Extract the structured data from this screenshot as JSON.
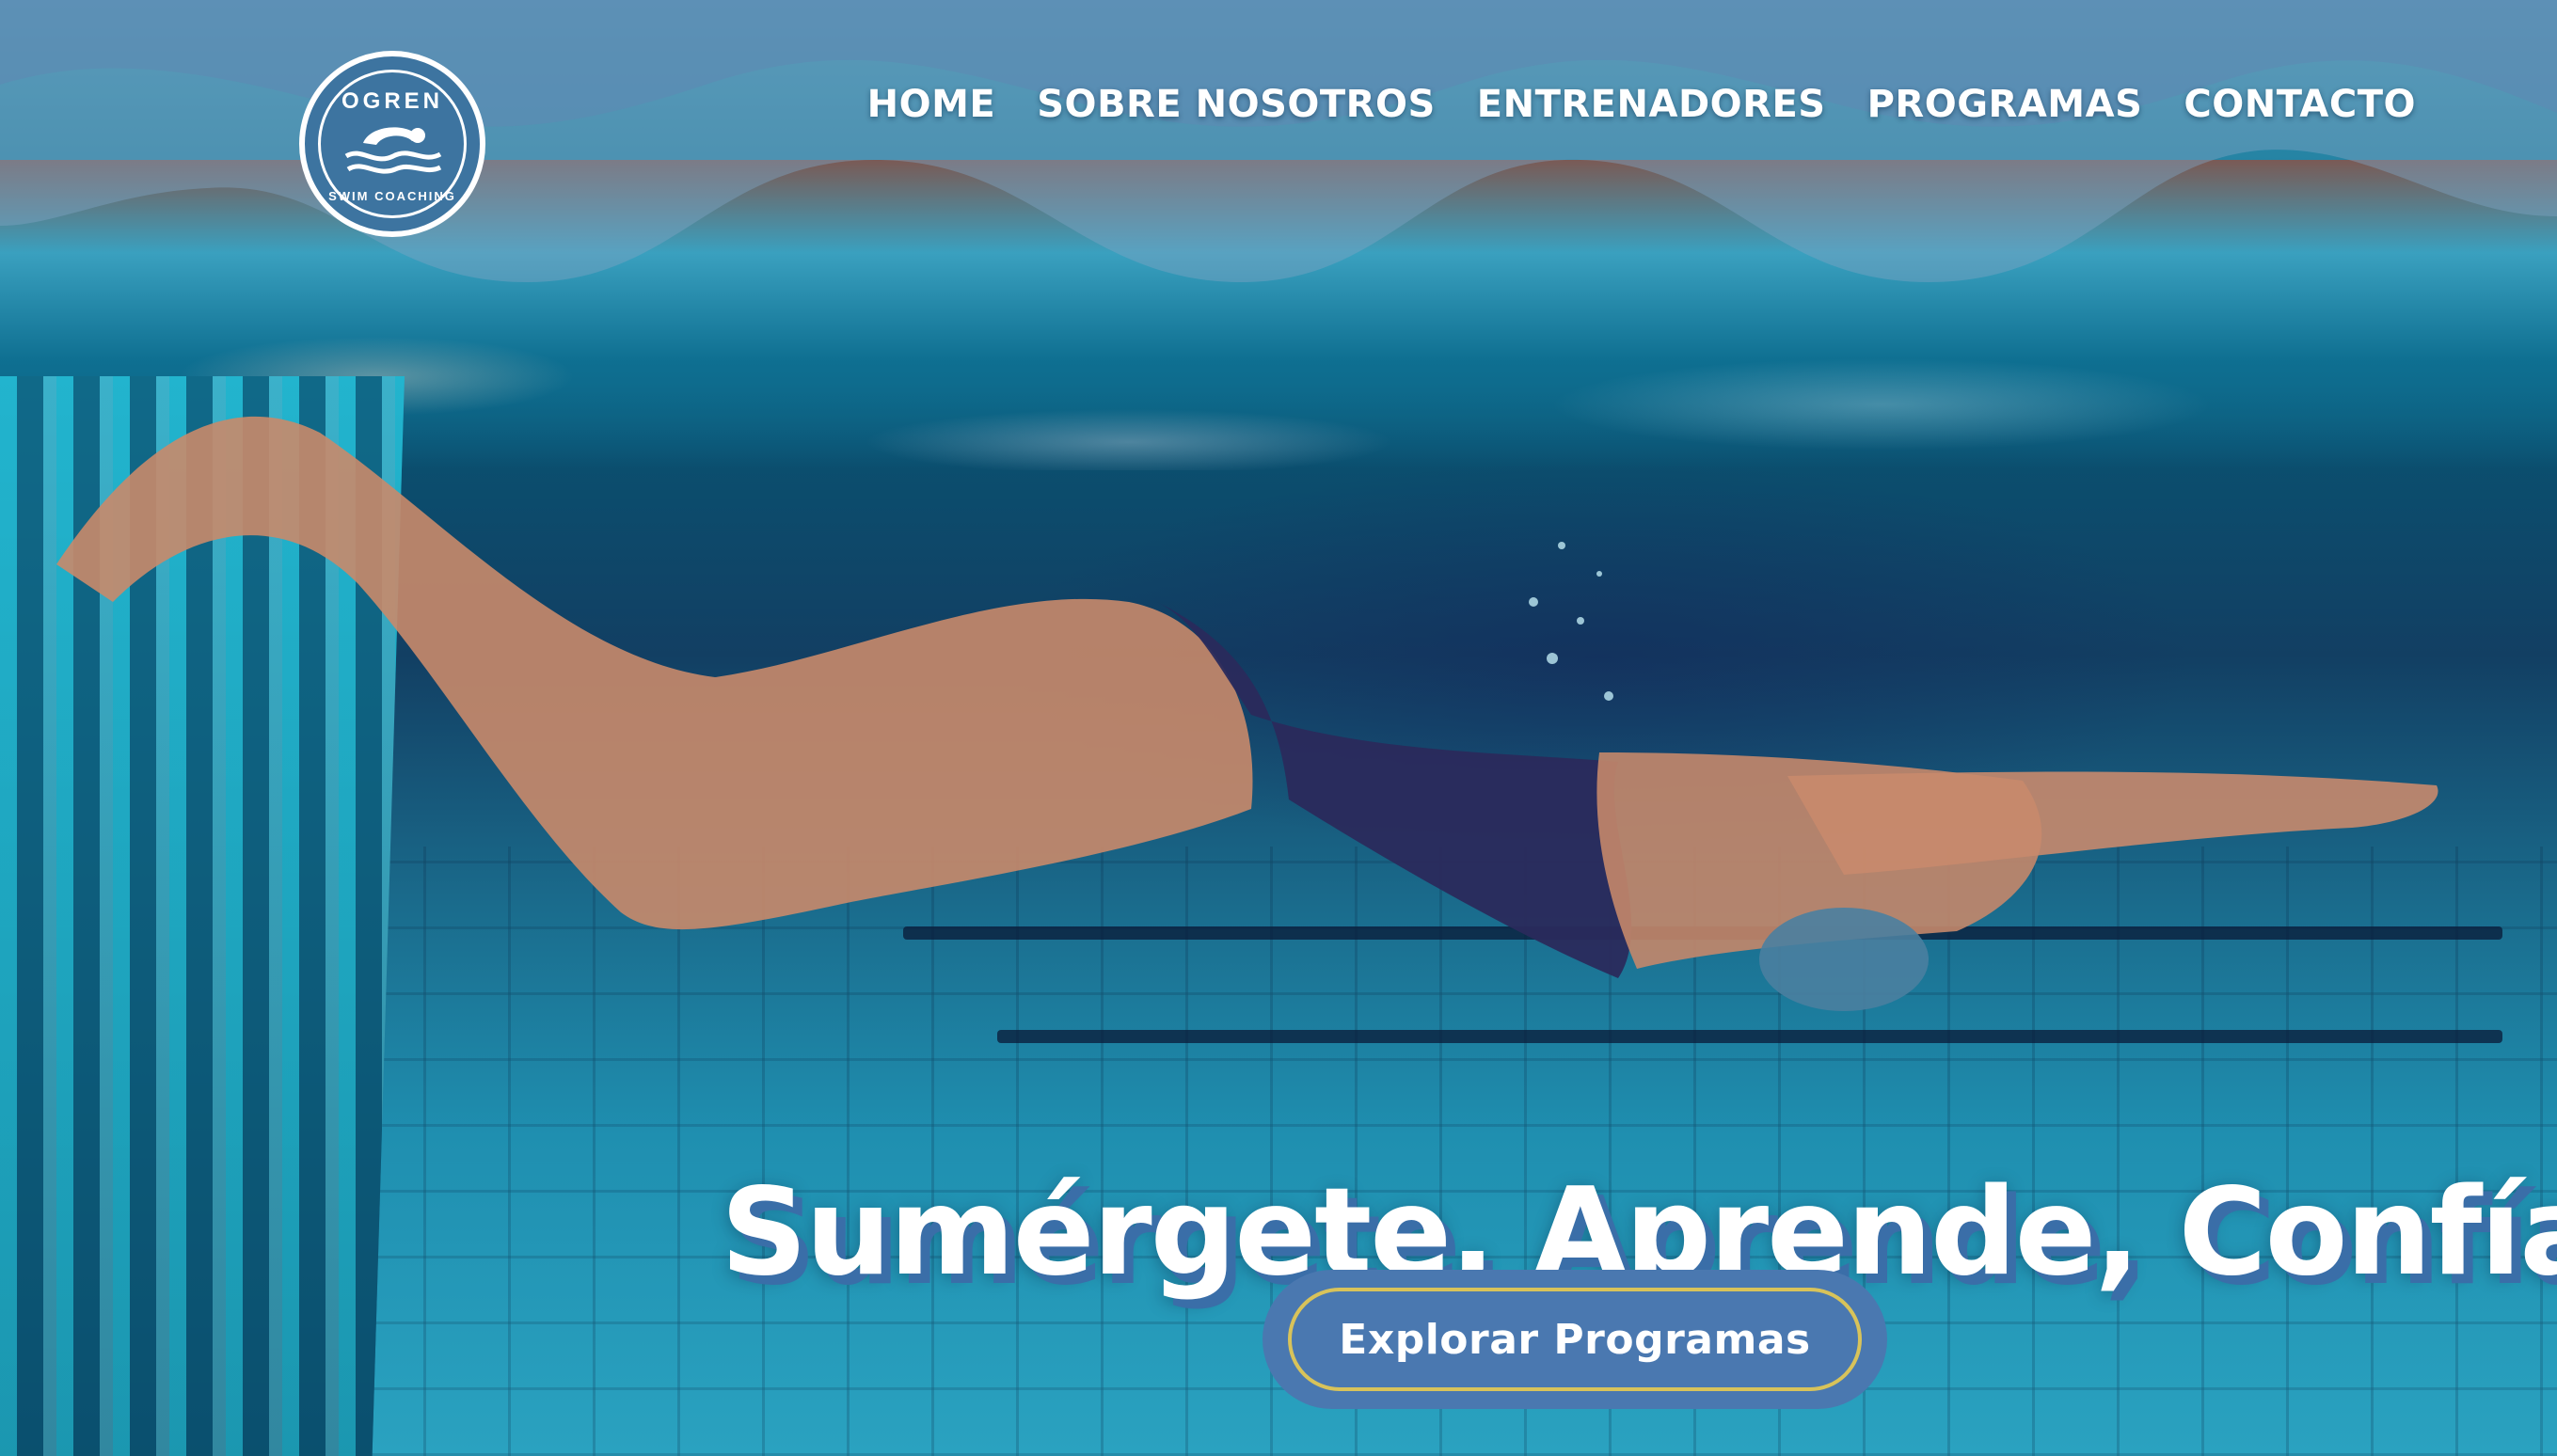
{
  "brand": {
    "logo_top_text": "OGREN",
    "logo_bottom_text": "SWIM COACHING"
  },
  "nav": {
    "items": [
      "HOME",
      "SOBRE NOSOTROS",
      "ENTRENADORES",
      "PROGRAMAS",
      "CONTACTO"
    ]
  },
  "hero": {
    "headline": "Sumérgete, Aprende, Confía",
    "cta_label": "Explorar Programas"
  },
  "colors": {
    "brand_blue": "#3d74a0",
    "cta_fill": "#4a78b0",
    "cta_border": "#d8c35a",
    "headline_shadow": "#3a6ea8",
    "text": "#ffffff"
  },
  "icons": {
    "logo_icon": "swimmer-wave-icon"
  }
}
